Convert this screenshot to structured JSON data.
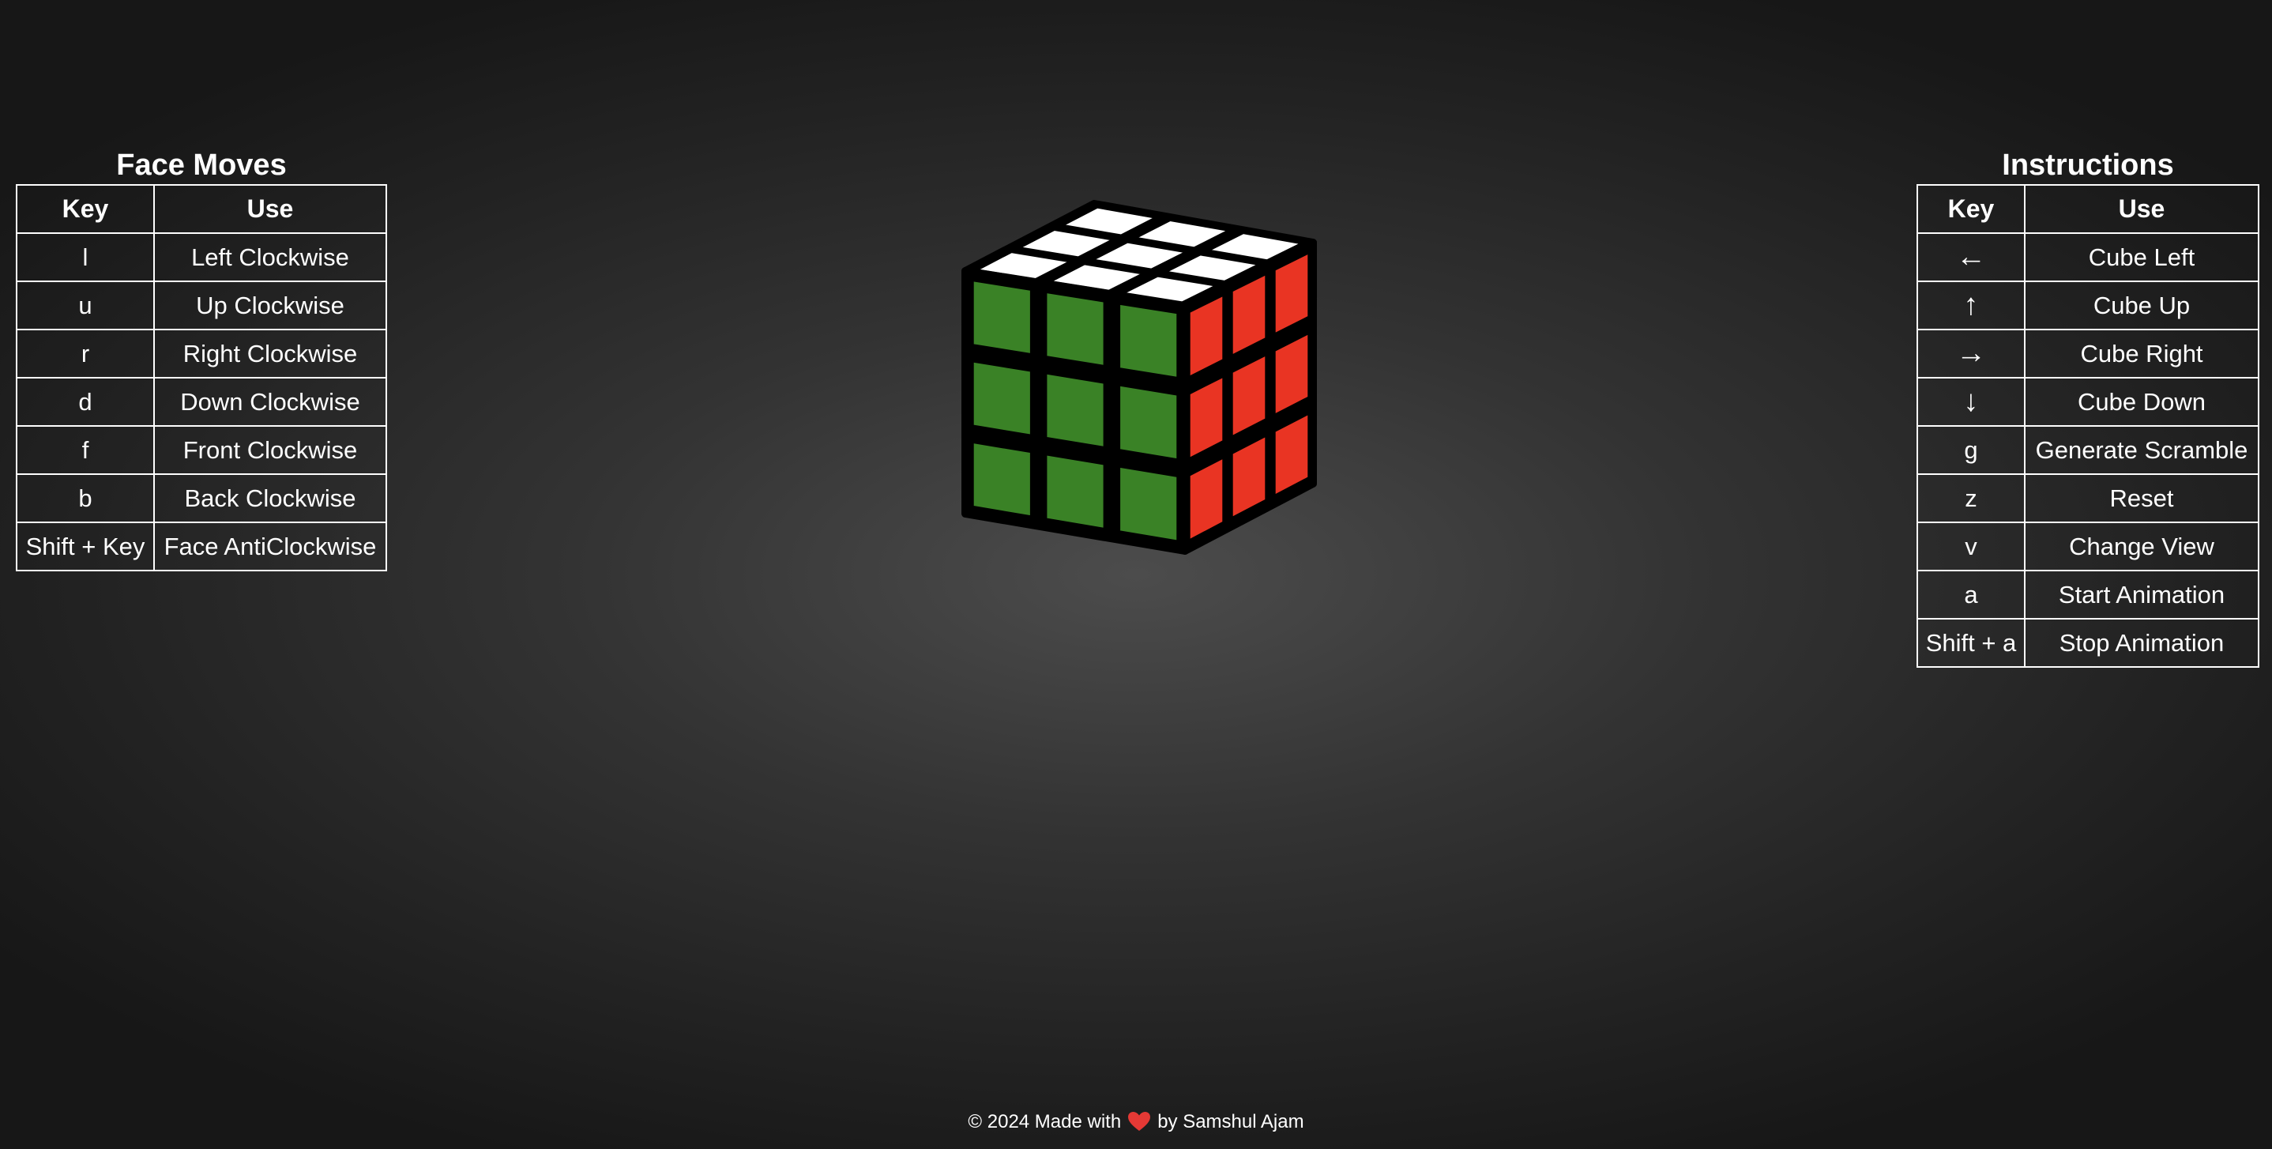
{
  "face_moves": {
    "title": "Face Moves",
    "headers": [
      "Key",
      "Use"
    ],
    "rows": [
      {
        "key": "l",
        "use": "Left Clockwise"
      },
      {
        "key": "u",
        "use": "Up Clockwise"
      },
      {
        "key": "r",
        "use": "Right Clockwise"
      },
      {
        "key": "d",
        "use": "Down Clockwise"
      },
      {
        "key": "f",
        "use": "Front Clockwise"
      },
      {
        "key": "b",
        "use": "Back Clockwise"
      },
      {
        "key": "Shift + Key",
        "use": "Face AntiClockwise"
      }
    ]
  },
  "instructions": {
    "title": "Instructions",
    "headers": [
      "Key",
      "Use"
    ],
    "rows": [
      {
        "key": "←",
        "use": "Cube Left"
      },
      {
        "key": "↑",
        "use": "Cube Up"
      },
      {
        "key": "→",
        "use": "Cube Right"
      },
      {
        "key": "↓",
        "use": "Cube Down"
      },
      {
        "key": "g",
        "use": "Generate Scramble"
      },
      {
        "key": "z",
        "use": "Reset"
      },
      {
        "key": "v",
        "use": "Change View"
      },
      {
        "key": "a",
        "use": "Start Animation"
      },
      {
        "key": "Shift + a",
        "use": "Stop Animation"
      }
    ]
  },
  "cube": {
    "top_face_color": "#ffffff",
    "front_face_color": "#3a8226",
    "right_face_color": "#e93423",
    "border_color": "#000000"
  },
  "footer": {
    "prefix": "© 2024 Made with",
    "icon": "heart-icon",
    "icon_color": "#e53935",
    "suffix": "by Samshul Ajam"
  }
}
